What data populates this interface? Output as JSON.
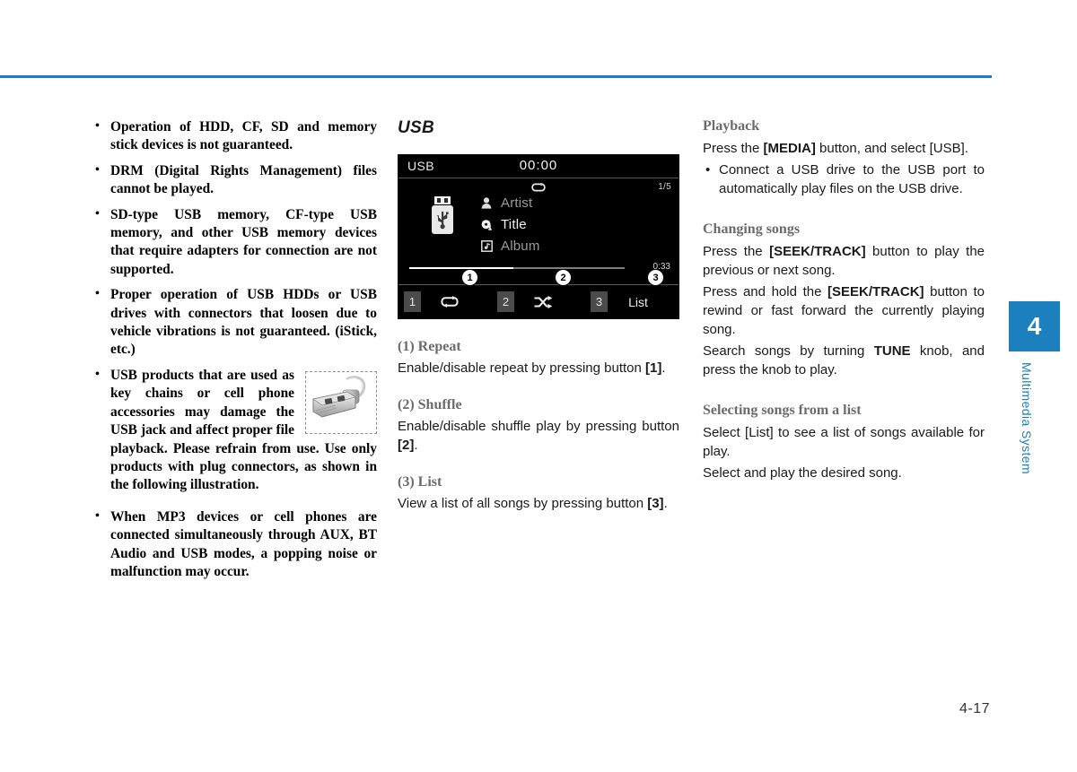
{
  "page": {
    "folio": "4-17",
    "rule_color": "#1b80bd"
  },
  "chapter_tab": {
    "number": "4",
    "label": "Multimedia System",
    "color": "#1b80bd"
  },
  "left_column": {
    "notes": [
      "Operation of HDD, CF, SD and memory stick devices is not guaranteed.",
      "DRM (Digital Rights Management) files cannot be played.",
      "SD-type USB memory, CF-type USB memory, and other USB memory devices that require adapters for connection are not supported.",
      "Proper operation of USB HDDs or USB drives with connectors that loosen due to vehicle vibrations is not guaranteed. (iStick, etc.)",
      "USB products that are used as key chains or cell phone accessories may damage the USB jack and affect proper file playback. Please refrain from use. Use only products with plug connectors, as shown in the following illustration.",
      "When MP3 devices or cell phones are connected simultaneously through AUX, BT Audio and USB modes, a popping noise or malfunction may occur."
    ],
    "figure_name": "usb-plug-photo"
  },
  "middle_column": {
    "heading": "USB",
    "screen": {
      "source": "USB",
      "clock": "00:00",
      "repeat_icon": "repeat-icon",
      "track_count": "1/5",
      "thumbnail_icon": "usb-drive-icon",
      "metadata": [
        {
          "icon": "artist-person-icon",
          "text": "Artist",
          "highlight": false
        },
        {
          "icon": "title-note-icon",
          "text": "Title",
          "highlight": true
        },
        {
          "icon": "album-art-icon",
          "text": "Album",
          "highlight": false
        }
      ],
      "elapsed_time": "0:33",
      "progress_percent": 48,
      "footer": [
        {
          "num": "1",
          "icon": "repeat-icon",
          "label": "",
          "callout": "❶"
        },
        {
          "num": "2",
          "icon": "shuffle-icon",
          "label": "",
          "callout": "❷"
        },
        {
          "num": "3",
          "icon": "",
          "label": "List",
          "callout": "❸"
        }
      ],
      "callouts": [
        "1",
        "2",
        "3"
      ]
    },
    "sections": [
      {
        "heading": "(1) Repeat",
        "body_pre": "Enable/disable repeat by pressing button ",
        "body_bold": "[1]",
        "body_post": "."
      },
      {
        "heading": "(2) Shuffle",
        "body_pre": "Enable/disable shuffle play by pressing button ",
        "body_bold": "[2]",
        "body_post": "."
      },
      {
        "heading": "(3) List",
        "body_pre": "View a list of all songs by pressing button ",
        "body_bold": "[3]",
        "body_post": "."
      }
    ]
  },
  "right_column": {
    "playback": {
      "heading": "Playback",
      "para_pre": "Press the ",
      "para_bold": "[MEDIA]",
      "para_post": " button, and select [USB].",
      "bullets": [
        "Connect a USB drive to the USB port to automatically play files on the USB drive."
      ]
    },
    "changing_songs": {
      "heading": "Changing songs",
      "p1_pre": "Press the ",
      "p1_bold": "[SEEK/TRACK]",
      "p1_post": " button to play the previous or next song.",
      "p2_pre": "Press and hold the ",
      "p2_bold": "[SEEK/TRACK]",
      "p2_post": " button to rewind or fast forward the currently playing song.",
      "p3_pre": "Search songs by turning ",
      "p3_bold": "TUNE",
      "p3_post": " knob, and press the knob to play."
    },
    "selecting_songs": {
      "heading": "Selecting songs from a list",
      "p1": "Select [List] to see a list of songs available for play.",
      "p2": "Select and play the desired song."
    }
  }
}
